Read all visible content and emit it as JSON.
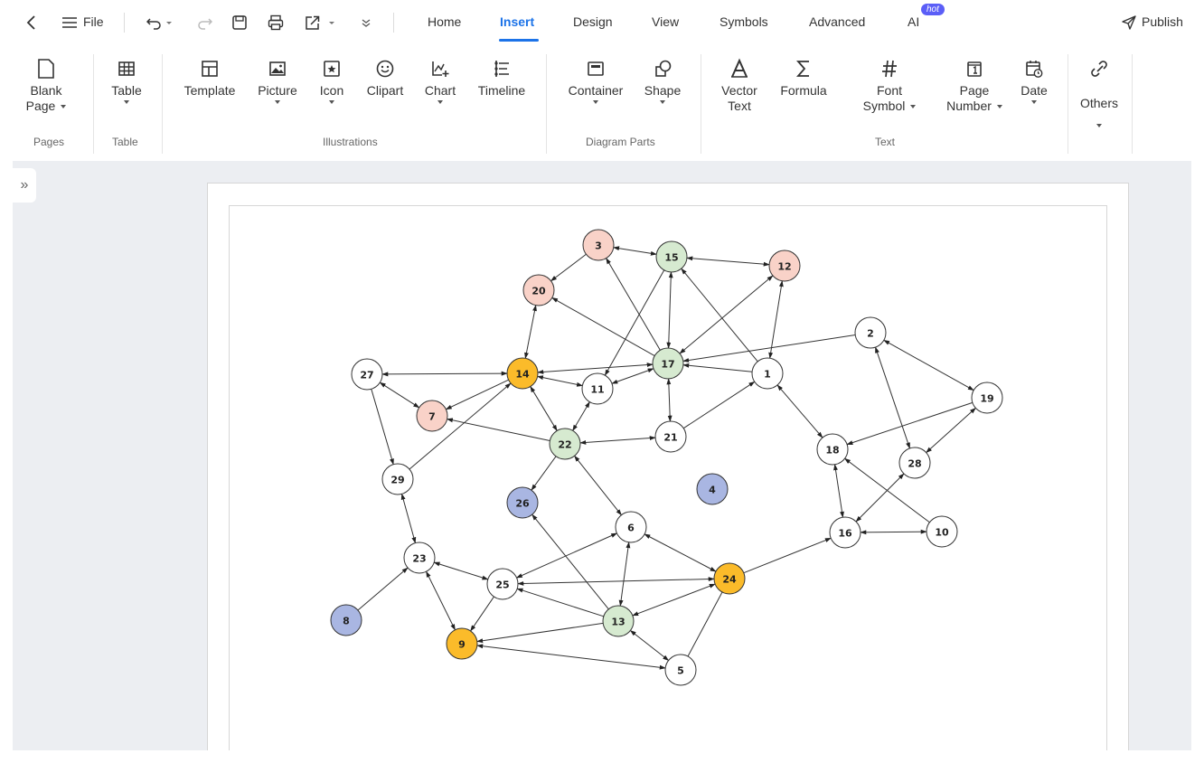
{
  "toolbar": {
    "file_label": "File",
    "publish_label": "Publish",
    "ai_badge": "hot"
  },
  "tabs": [
    {
      "label": "Home"
    },
    {
      "label": "Insert"
    },
    {
      "label": "Design"
    },
    {
      "label": "View"
    },
    {
      "label": "Symbols"
    },
    {
      "label": "Advanced"
    },
    {
      "label": "AI"
    }
  ],
  "ribbon": {
    "blank_page_line1": "Blank",
    "blank_page_line2": "Page",
    "table": "Table",
    "template": "Template",
    "picture": "Picture",
    "icon": "Icon",
    "clipart": "Clipart",
    "chart": "Chart",
    "timeline": "Timeline",
    "container": "Container",
    "shape": "Shape",
    "vector_text_line1": "Vector",
    "vector_text_line2": "Text",
    "formula": "Formula",
    "font_symbol_line1": "Font",
    "font_symbol_line2": "Symbol",
    "page_number_line1": "Page",
    "page_number_line2": "Number",
    "date": "Date",
    "others": "Others",
    "groups": {
      "pages": "Pages",
      "table": "Table",
      "illustrations": "Illustrations",
      "diagram_parts": "Diagram Parts",
      "text": "Text"
    }
  },
  "colors": {
    "accent": "#1c73e8",
    "node_orange": "#fbbb2a",
    "node_green": "#d6ead0",
    "node_pink": "#f9d2c8",
    "node_blue": "#a9b6e2",
    "node_white": "#ffffff"
  },
  "graph": {
    "nodes": [
      {
        "id": "1",
        "color": "white"
      },
      {
        "id": "2",
        "color": "white"
      },
      {
        "id": "3",
        "color": "pink"
      },
      {
        "id": "4",
        "color": "blue"
      },
      {
        "id": "5",
        "color": "white"
      },
      {
        "id": "6",
        "color": "white"
      },
      {
        "id": "7",
        "color": "pink"
      },
      {
        "id": "8",
        "color": "blue"
      },
      {
        "id": "9",
        "color": "orange"
      },
      {
        "id": "10",
        "color": "white"
      },
      {
        "id": "11",
        "color": "white"
      },
      {
        "id": "12",
        "color": "pink"
      },
      {
        "id": "13",
        "color": "green"
      },
      {
        "id": "14",
        "color": "orange"
      },
      {
        "id": "15",
        "color": "green"
      },
      {
        "id": "16",
        "color": "white"
      },
      {
        "id": "17",
        "color": "green"
      },
      {
        "id": "18",
        "color": "white"
      },
      {
        "id": "19",
        "color": "white"
      },
      {
        "id": "20",
        "color": "pink"
      },
      {
        "id": "21",
        "color": "white"
      },
      {
        "id": "22",
        "color": "green"
      },
      {
        "id": "23",
        "color": "white"
      },
      {
        "id": "24",
        "color": "orange"
      },
      {
        "id": "25",
        "color": "white"
      },
      {
        "id": "26",
        "color": "blue"
      },
      {
        "id": "27",
        "color": "white"
      },
      {
        "id": "28",
        "color": "white"
      },
      {
        "id": "29",
        "color": "white"
      }
    ],
    "edges": [
      {
        "from": "3",
        "to": "15",
        "dir": "both"
      },
      {
        "from": "15",
        "to": "12",
        "dir": "both"
      },
      {
        "from": "3",
        "to": "20",
        "dir": "end"
      },
      {
        "from": "3",
        "to": "17",
        "dir": "start"
      },
      {
        "from": "15",
        "to": "17",
        "dir": "both"
      },
      {
        "from": "15",
        "to": "1",
        "dir": "start"
      },
      {
        "from": "15",
        "to": "11",
        "dir": "end"
      },
      {
        "from": "12",
        "to": "17",
        "dir": "both"
      },
      {
        "from": "12",
        "to": "1",
        "dir": "both"
      },
      {
        "from": "20",
        "to": "14",
        "dir": "both"
      },
      {
        "from": "20",
        "to": "17",
        "dir": "start"
      },
      {
        "from": "2",
        "to": "17",
        "dir": "end"
      },
      {
        "from": "2",
        "to": "19",
        "dir": "both"
      },
      {
        "from": "2",
        "to": "28",
        "dir": "both"
      },
      {
        "from": "27",
        "to": "14",
        "dir": "both"
      },
      {
        "from": "27",
        "to": "7",
        "dir": "both"
      },
      {
        "from": "27",
        "to": "29",
        "dir": "end"
      },
      {
        "from": "14",
        "to": "17",
        "dir": "both"
      },
      {
        "from": "14",
        "to": "11",
        "dir": "both"
      },
      {
        "from": "14",
        "to": "7",
        "dir": "end"
      },
      {
        "from": "14",
        "to": "22",
        "dir": "both"
      },
      {
        "from": "14",
        "to": "29",
        "dir": "start"
      },
      {
        "from": "17",
        "to": "1",
        "dir": "start"
      },
      {
        "from": "17",
        "to": "11",
        "dir": "both"
      },
      {
        "from": "17",
        "to": "21",
        "dir": "both"
      },
      {
        "from": "1",
        "to": "21",
        "dir": "start"
      },
      {
        "from": "1",
        "to": "18",
        "dir": "both"
      },
      {
        "from": "11",
        "to": "22",
        "dir": "both"
      },
      {
        "from": "7",
        "to": "22",
        "dir": "start"
      },
      {
        "from": "22",
        "to": "21",
        "dir": "both"
      },
      {
        "from": "22",
        "to": "26",
        "dir": "end"
      },
      {
        "from": "22",
        "to": "6",
        "dir": "both"
      },
      {
        "from": "19",
        "to": "18",
        "dir": "end"
      },
      {
        "from": "19",
        "to": "28",
        "dir": "both"
      },
      {
        "from": "18",
        "to": "16",
        "dir": "both"
      },
      {
        "from": "18",
        "to": "10",
        "dir": "start"
      },
      {
        "from": "28",
        "to": "16",
        "dir": "both"
      },
      {
        "from": "16",
        "to": "10",
        "dir": "both"
      },
      {
        "from": "16",
        "to": "24",
        "dir": "start"
      },
      {
        "from": "29",
        "to": "23",
        "dir": "both"
      },
      {
        "from": "6",
        "to": "25",
        "dir": "both"
      },
      {
        "from": "6",
        "to": "24",
        "dir": "both"
      },
      {
        "from": "6",
        "to": "13",
        "dir": "both"
      },
      {
        "from": "26",
        "to": "13",
        "dir": "start"
      },
      {
        "from": "23",
        "to": "25",
        "dir": "both"
      },
      {
        "from": "23",
        "to": "8",
        "dir": "start"
      },
      {
        "from": "23",
        "to": "9",
        "dir": "both"
      },
      {
        "from": "25",
        "to": "24",
        "dir": "both"
      },
      {
        "from": "25",
        "to": "13",
        "dir": "start"
      },
      {
        "from": "25",
        "to": "9",
        "dir": "end"
      },
      {
        "from": "24",
        "to": "13",
        "dir": "both"
      },
      {
        "from": "24",
        "to": "5",
        "dir": "none"
      },
      {
        "from": "13",
        "to": "9",
        "dir": "end"
      },
      {
        "from": "13",
        "to": "5",
        "dir": "both"
      },
      {
        "from": "9",
        "to": "5",
        "dir": "both"
      }
    ]
  }
}
